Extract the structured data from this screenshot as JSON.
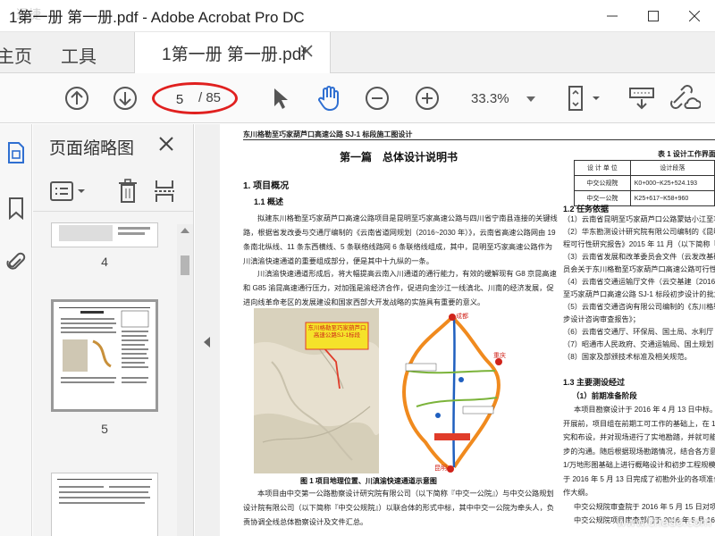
{
  "window": {
    "title": "1第一册 第一册.pdf - Adobe Acrobat Pro DC",
    "watermark": "迅捷",
    "controls": [
      "minimize",
      "maximize",
      "close"
    ]
  },
  "tabs": {
    "home": "主页",
    "tools": "工具",
    "document": "1第一册 第一册.pdf"
  },
  "toolbar": {
    "current_page": "5",
    "total_pages": "/ 85",
    "zoom": "33.3%",
    "accent": "#e0201f",
    "hand_color": "#2f6fd1"
  },
  "sidebar": {
    "panel_title": "页面缩略图",
    "thumbnails": [
      {
        "label": "4"
      },
      {
        "label": "5"
      }
    ]
  },
  "document": {
    "header": "东川格勒至巧家葫芦口高速公路 SJ-1 标段施工图设计",
    "chapter": "第一篇　总体设计说明书",
    "s1": "1. 项目概况",
    "s11": "1.1 概述",
    "p1": "拟建东川格勒至巧家葫芦口高速公路项目是昆明至巧家高速公路与四川省宁南县连接的关键线路，根据省发改委与交通厅编制的《云南省道网规划（2016~2030 年）》，云南省高速公路网由 19 条南北纵线、11 条东西横线、5 条联络线路网 6 条联络线组成，其中，昆明至巧家高速公路作为川滇渝快速通道的重要组成部分，便是其中十九纵的一条。",
    "p2": "川滇渝快速通道形成后，将大幅提高云南入川通道的通行能力，有效的缓解现有 G8 京昆高速和 G85 渝昆高速通行压力，对加强是渝经济合作，促进向金沙江一线滇北、川南的经济发展，促进向线革命老区的发展建设和国家西部大开发战略的实施具有重要的意义。",
    "table_title": "表 1  设计工作界面",
    "table_header": [
      "设 计 单 位",
      "设计段落"
    ],
    "table_rows": [
      [
        "中交公规院",
        "K0+000~K25+524.193"
      ],
      [
        "中交一公院",
        "K25+617~K58+960"
      ]
    ],
    "s12": "1.2 任务依据",
    "r1": "（1）云南省昆明至巧家葫芦口公路蒙姑小江至巧",
    "r2": "（2）华东勘测设计研究院有限公司编制的《昆明",
    "r3": "程可行性研究报告》2015 年 11 月（以下简称『工可",
    "r4": "（3）云南省发展和改革委员会文件（云发改基础",
    "r5": "员会关于东川格勒至巧家葫芦口高速公路可行性研究",
    "r6": "（4）云南省交通运输厅文件（云交基建〔2016〕",
    "r7": "至巧家葫芦口高速公路 SJ-1 标段初步设计的批复》；",
    "r8": "（5）云南省交通咨询有限公司编制的《东川格勒",
    "r9": "步设计咨询审查报告》；",
    "r10": "（6）云南省交通厅、环保局、国土局、水利厅",
    "r11": "（7）昭通市人民政府、交通运输局、国土规划",
    "r12": "（8）国家及部颁技术标准及相关规范。",
    "s13": "1.3 主要测设经过",
    "s131": "（1）前期准备阶段",
    "q1": "本项目勘察设计于 2016 年 4 月 13 日中标。之后",
    "q2": "开展前，项目组在前期工可工作的基础上，在 1/万地",
    "q3": "究和布设，并对现场进行了实地勘踏，并就可能的路",
    "q4": "步的沟通。随后根据现场勘踏情况，结合各方意见对",
    "q5": "1/万地形图基础上进行概略设计和初步工程规模统计",
    "q6": "于 2016 年 5 月 13 日完成了初勘外业的各项准备工",
    "q7": "作大纲。",
    "q8": "中交公规院审查院于 2016 年 5 月 15 日对项目",
    "q9": "中交公规院项目审查部门于 2016 年 5 月 16 日",
    "map_label": "东川格勒至巧家葫芦口高速公路SJ-1标段",
    "cities": {
      "chengdu": "成都",
      "chongqing": "重庆",
      "kunming": "昆明"
    },
    "caption": "图 1  项目地理位置、川滇渝快速通道示意图",
    "p3": "本项目由中交第一公路勘察设计研究院有限公司（以下简称『中交一公院』）与中交公路规划设计院有限公司（以下简称『中交公规院』）以联合体的形式中标，其中中交一公院为牵头人，负责协调全线总体勘察设计及文件汇总。",
    "site_watermark": "www.cnado.com"
  }
}
